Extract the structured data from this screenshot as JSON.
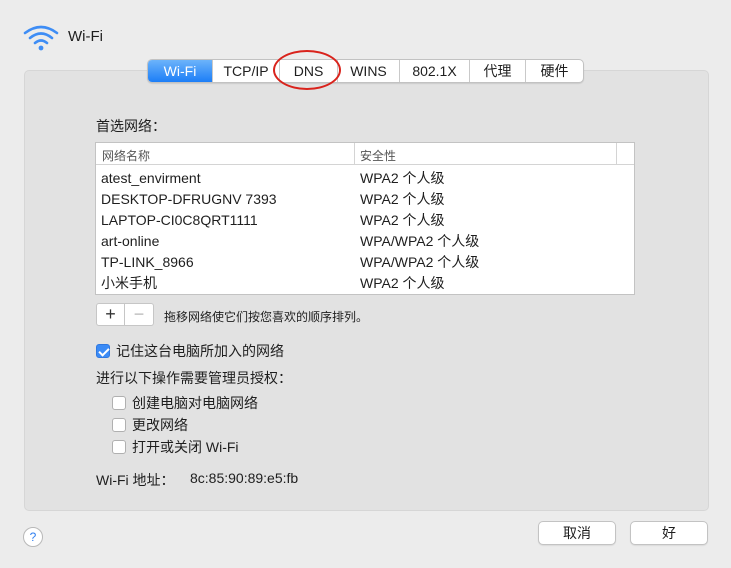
{
  "header": {
    "title": "Wi-Fi",
    "icon": "wifi-icon"
  },
  "tabs": [
    {
      "label": "Wi-Fi",
      "active": true
    },
    {
      "label": "TCP/IP",
      "active": false
    },
    {
      "label": "DNS",
      "active": false,
      "highlighted": true
    },
    {
      "label": "WINS",
      "active": false
    },
    {
      "label": "802.1X",
      "active": false
    },
    {
      "label": "代理",
      "active": false
    },
    {
      "label": "硬件",
      "active": false
    }
  ],
  "preferred": {
    "label": "首选网络：",
    "columns": [
      "网络名称",
      "安全性"
    ],
    "rows": [
      {
        "name": "atest_envirment",
        "security": "WPA2 个人级"
      },
      {
        "name": "DESKTOP-DFRUGNV 7393",
        "security": "WPA2 个人级"
      },
      {
        "name": "LAPTOP-CI0C8QRT1111",
        "security": "WPA2 个人级"
      },
      {
        "name": "art-online",
        "security": "WPA/WPA2 个人级"
      },
      {
        "name": "TP-LINK_8966",
        "security": "WPA/WPA2 个人级"
      },
      {
        "name": "小米手机",
        "security": "WPA2 个人级"
      }
    ],
    "add_label": "+",
    "remove_label": "−",
    "hint": "拖移网络使它们按您喜欢的顺序排列。"
  },
  "remember": {
    "label": "记住这台电脑所加入的网络",
    "checked": true
  },
  "admin": {
    "label": "进行以下操作需要管理员授权：",
    "options": [
      {
        "label": "创建电脑对电脑网络",
        "checked": false
      },
      {
        "label": "更改网络",
        "checked": false
      },
      {
        "label": "打开或关闭 Wi-Fi",
        "checked": false
      }
    ]
  },
  "address": {
    "label": "Wi-Fi 地址：",
    "value": "8c:85:90:89:e5:fb"
  },
  "footer": {
    "help_label": "?",
    "cancel_label": "取消",
    "ok_label": "好"
  },
  "colors": {
    "accent": "#1c7ef7",
    "highlight_circle": "#d9231c"
  }
}
